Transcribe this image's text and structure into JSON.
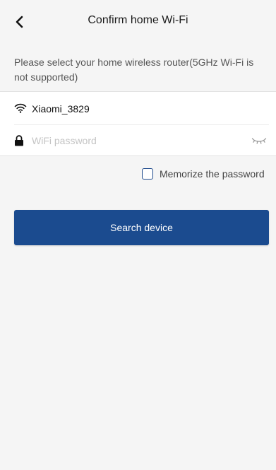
{
  "header": {
    "title": "Confirm home Wi-Fi",
    "back_icon": "chevron-left-icon"
  },
  "hint": "Please select your home wireless router(5GHz Wi-Fi is not supported)",
  "network": {
    "icon": "wifi-icon",
    "ssid": "Xiaomi_3829"
  },
  "password": {
    "icon": "lock-icon",
    "value": "",
    "placeholder": "WiFi password",
    "visibility_icon": "eye-closed-icon"
  },
  "remember": {
    "label": "Memorize the password",
    "checked": false
  },
  "search_button": {
    "label": "Search device"
  },
  "colors": {
    "accent": "#1b4b8f",
    "background": "#f5f5f5",
    "card": "#ffffff"
  }
}
